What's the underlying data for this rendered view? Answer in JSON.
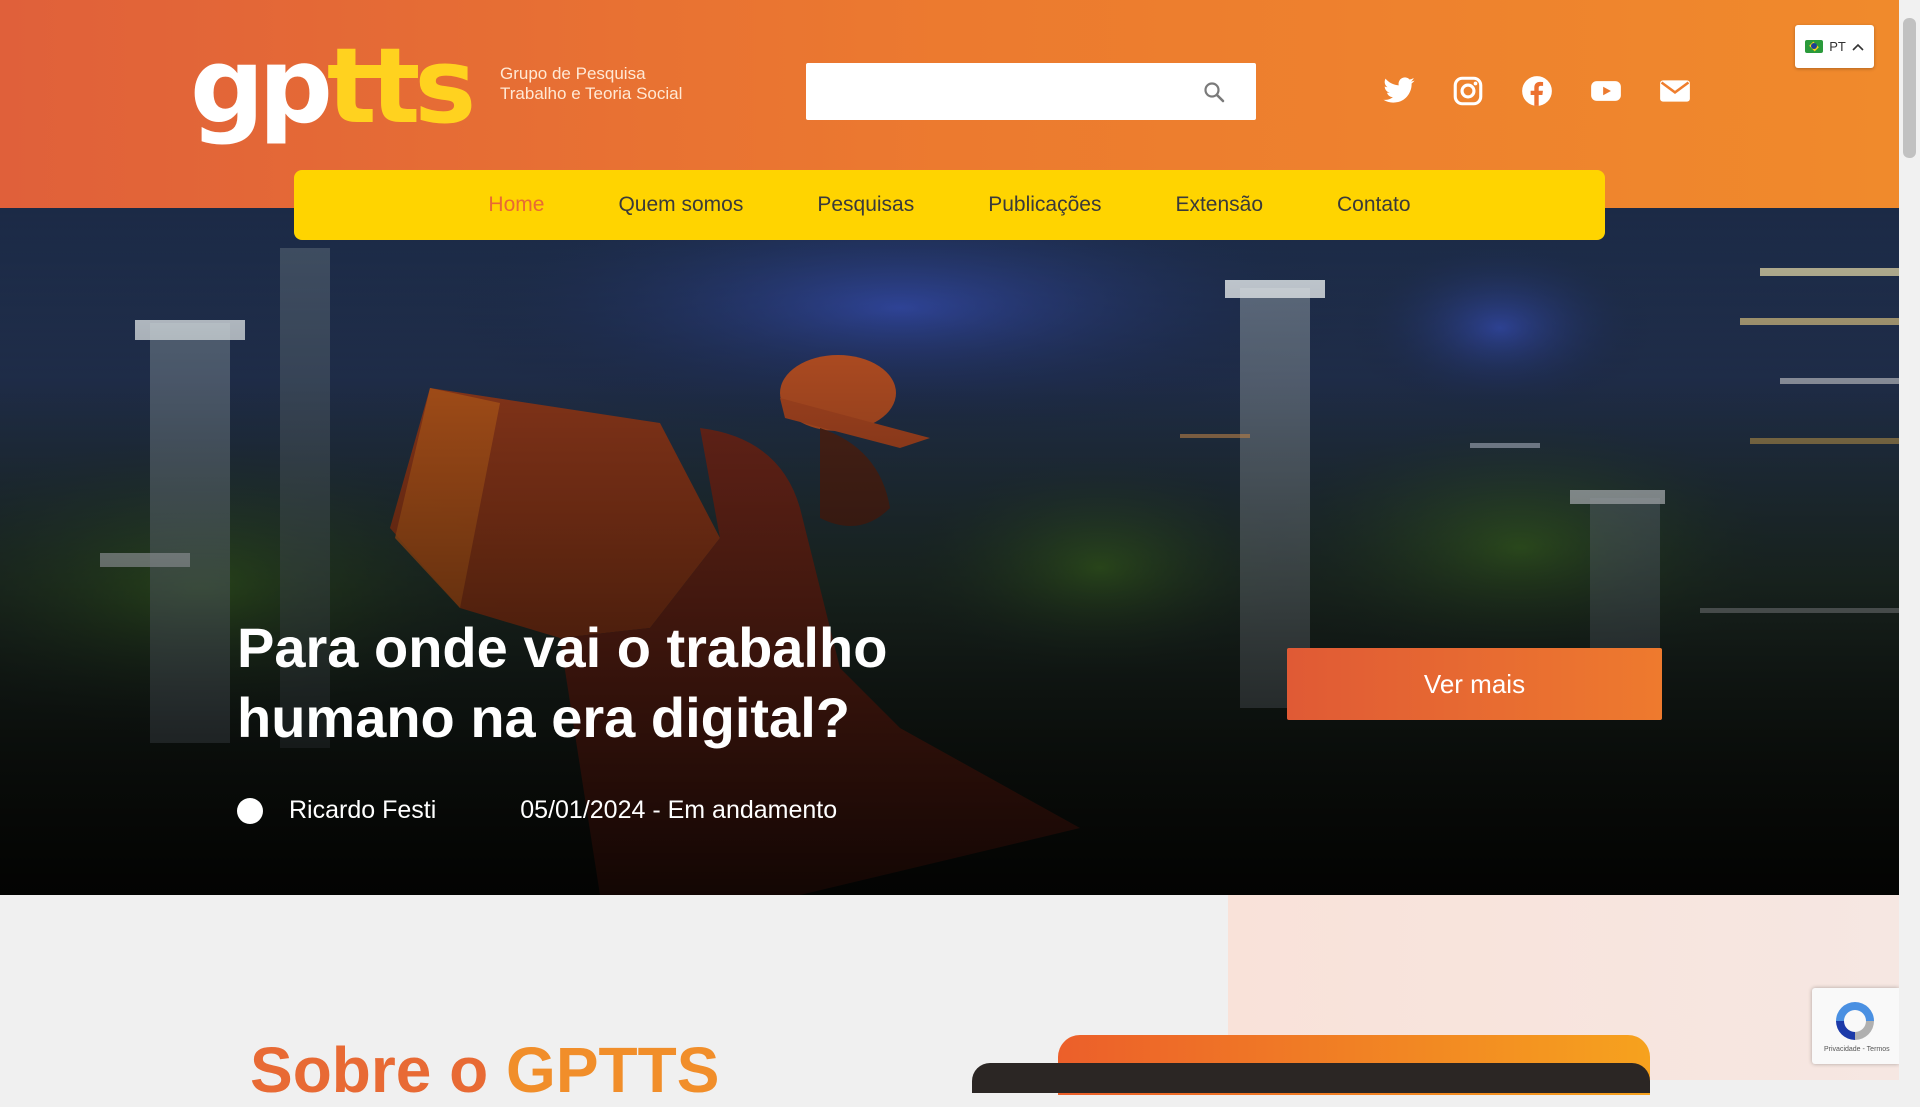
{
  "header": {
    "logo_gp": "gp",
    "logo_tts": "tts",
    "subtitle_line1": "Grupo de Pesquisa",
    "subtitle_line2": "Trabalho e Teoria Social",
    "search_placeholder": "",
    "social_icons": [
      "twitter-icon",
      "instagram-icon",
      "facebook-icon",
      "youtube-icon",
      "email-icon"
    ],
    "language": "PT"
  },
  "nav": {
    "items": [
      {
        "label": "Home",
        "active": true
      },
      {
        "label": "Quem somos",
        "active": false
      },
      {
        "label": "Pesquisas",
        "active": false
      },
      {
        "label": "Publicações",
        "active": false
      },
      {
        "label": "Extensão",
        "active": false
      },
      {
        "label": "Contato",
        "active": false
      }
    ]
  },
  "hero": {
    "title": "Para onde vai o trabalho humano na era digital?",
    "author": "Ricardo Festi",
    "date_status": "05/01/2024 - Em andamento",
    "cta_label": "Ver mais"
  },
  "about": {
    "title_part1": "Sobre o ",
    "title_part2": "GPTTS"
  },
  "recaptcha": {
    "footer_text": "Privacidade - Termos"
  },
  "colors": {
    "header_orange": "#e86a34",
    "nav_yellow": "#ffd400",
    "logo_yellow": "#ffd21f",
    "active_nav": "#e86a34"
  }
}
